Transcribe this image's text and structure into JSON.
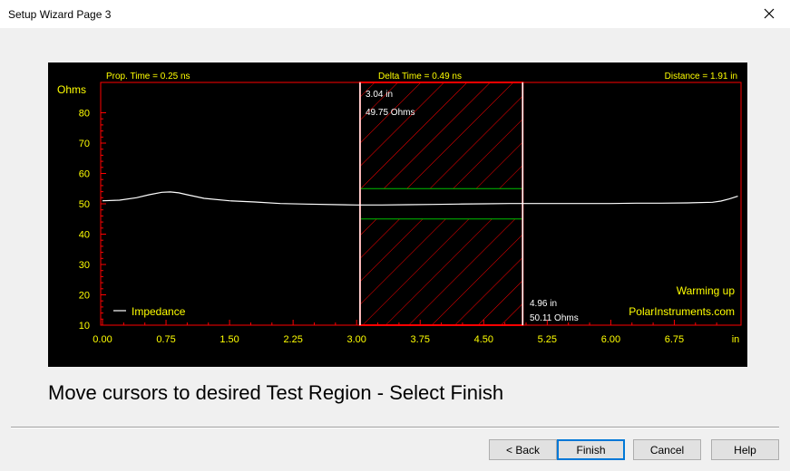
{
  "window": {
    "title": "Setup Wizard Page 3",
    "close_icon": "close-icon"
  },
  "header": {
    "prop_time": "Prop. Time = 0.25 ns",
    "delta_time": "Delta Time = 0.49 ns",
    "distance": "Distance = 1.91 in"
  },
  "cursors": {
    "left": {
      "position": "3.04 in",
      "impedance": "49.75 Ohms",
      "x": 3.04
    },
    "right": {
      "position": "4.96 in",
      "impedance": "50.11 Ohms",
      "x": 4.96
    },
    "band_upper": 55,
    "band_lower": 45
  },
  "status": {
    "warming": "Warming up",
    "brand": "PolarInstruments.com"
  },
  "colors": {
    "axis": "#ff0000",
    "text": "#ffff00",
    "trace": "#ffffff",
    "band": "#00c000",
    "background": "#000000"
  },
  "chart_data": {
    "type": "line",
    "ylabel": "Ohms",
    "xlabel": "in",
    "xlim": [
      0,
      7.5
    ],
    "ylim": [
      10,
      90
    ],
    "xticks": [
      "0.00",
      "0.75",
      "1.50",
      "2.25",
      "3.00",
      "3.75",
      "4.50",
      "5.25",
      "6.00",
      "6.75"
    ],
    "yticks": [
      "10",
      "20",
      "30",
      "40",
      "50",
      "60",
      "70",
      "80"
    ],
    "series": [
      {
        "name": "Impedance",
        "x": [
          0,
          0.2,
          0.4,
          0.55,
          0.7,
          0.8,
          0.9,
          1.0,
          1.2,
          1.5,
          1.8,
          2.1,
          2.4,
          2.8,
          3.0,
          3.3,
          3.6,
          3.9,
          4.2,
          4.5,
          4.8,
          5.1,
          5.4,
          5.7,
          6.0,
          6.3,
          6.6,
          6.9,
          7.2,
          7.3,
          7.4,
          7.5
        ],
        "y": [
          51,
          51.2,
          52,
          53,
          53.8,
          53.9,
          53.6,
          53,
          51.8,
          51,
          50.6,
          50.1,
          49.9,
          49.7,
          49.6,
          49.6,
          49.7,
          49.8,
          49.9,
          50,
          50.1,
          50.1,
          50.1,
          50.1,
          50.1,
          50.2,
          50.2,
          50.3,
          50.5,
          50.9,
          51.6,
          52.5
        ]
      }
    ]
  },
  "instruction": "Move cursors to desired Test Region - Select Finish",
  "buttons": {
    "back": "< Back",
    "finish": "Finish",
    "cancel": "Cancel",
    "help": "Help"
  }
}
